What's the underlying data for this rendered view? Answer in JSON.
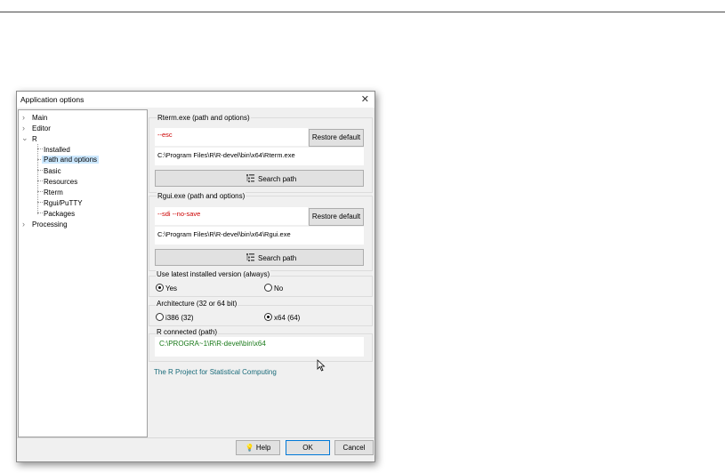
{
  "window": {
    "title": "Application options",
    "close_glyph": "✕"
  },
  "tree": {
    "items": [
      {
        "label": "Main",
        "has_chevron": true,
        "expanded": false
      },
      {
        "label": "Editor",
        "has_chevron": true,
        "expanded": false
      },
      {
        "label": "R",
        "has_chevron": true,
        "expanded": true
      },
      {
        "label": "Installed"
      },
      {
        "label": "Path and options",
        "selected": true
      },
      {
        "label": "Basic"
      },
      {
        "label": "Resources"
      },
      {
        "label": "Rterm"
      },
      {
        "label": "Rgui/PuTTY"
      },
      {
        "label": "Packages"
      },
      {
        "label": "Processing",
        "has_chevron": true,
        "expanded": false
      }
    ]
  },
  "rterm": {
    "group_title": "Rterm.exe (path and options)",
    "options_value": "--esc",
    "restore_label": "Restore default",
    "path": "C:\\Program Files\\R\\R-devel\\bin\\x64\\Rterm.exe",
    "search_label": "Search path"
  },
  "rgui": {
    "group_title": "Rgui.exe (path and options)",
    "options_value": "--sdi --no-save",
    "restore_label": "Restore default",
    "path": "C:\\Program Files\\R\\R-devel\\bin\\x64\\Rgui.exe",
    "search_label": "Search path"
  },
  "latest": {
    "group_title": "Use latest installed version (always)",
    "yes_label": "Yes",
    "no_label": "No",
    "selected": "Yes"
  },
  "arch": {
    "group_title": "Architecture (32 or 64 bit)",
    "opt1_label": "i386 (32)",
    "opt2_label": "x64 (64)",
    "selected": "x64 (64)"
  },
  "connected": {
    "group_title": "R connected (path)",
    "path": "C:\\PROGRA~1\\R\\R-devel\\bin\\x64"
  },
  "link_text": "The R Project for Statistical Computing",
  "footer": {
    "help_label": "Help",
    "ok_label": "OK",
    "cancel_label": "Cancel"
  },
  "colors": {
    "options_text": "#cc0000",
    "connected_path": "#1a7a1a",
    "link": "#1a6b7a",
    "selection": "#cce8ff"
  },
  "icons": {
    "search": "tree-search-icon",
    "help": "help-bulb-icon",
    "cursor": "mouse-cursor-icon"
  }
}
